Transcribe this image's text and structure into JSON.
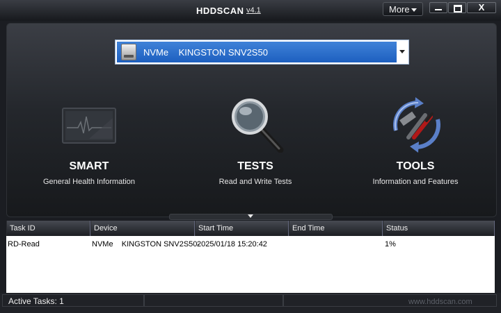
{
  "window": {
    "title": "HDDSCAN",
    "version": "v4.1",
    "more_label": "More",
    "close_glyph": "X"
  },
  "device": {
    "selected": "NVMe    KINGSTON SNV2S50"
  },
  "features": [
    {
      "title": "SMART",
      "subtitle": "General Health Information",
      "icon": "monitor-heartbeat-icon"
    },
    {
      "title": "TESTS",
      "subtitle": "Read and Write Tests",
      "icon": "magnifier-icon"
    },
    {
      "title": "TOOLS",
      "subtitle": "Information and Features",
      "icon": "tools-refresh-icon"
    }
  ],
  "tasks": {
    "columns": [
      "Task ID",
      "Device",
      "Start Time",
      "End Time",
      "Status"
    ],
    "rows": [
      {
        "task_id": "RD-Read",
        "device": "NVMe    KINGSTON SNV2S50-",
        "start_time": "2025/01/18 15:20:42",
        "end_time": "",
        "status": "1%"
      }
    ]
  },
  "status_bar": {
    "active_tasks": "Active Tasks: 1",
    "site": "www.hddscan.com"
  },
  "colors": {
    "accent_blue": "#2a6fd0",
    "background": "#1b1d22"
  }
}
